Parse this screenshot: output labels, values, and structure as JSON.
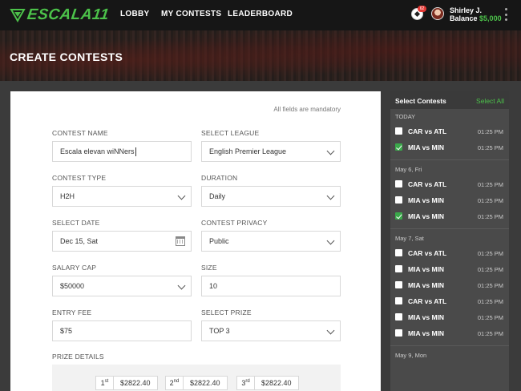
{
  "app": {
    "logo_text": "ESCALA11"
  },
  "nav": {
    "items": [
      {
        "label": "LOBBY"
      },
      {
        "label": "MY CONTESTS"
      },
      {
        "label": "LEADERBOARD"
      }
    ]
  },
  "user": {
    "notification_count": "62",
    "name": "Shirley J.",
    "balance_label": "Balance",
    "balance_amount": "$5,000"
  },
  "hero": {
    "title": "CREATE CONTESTS"
  },
  "form": {
    "mandatory_note": "All fields are mandatory",
    "contest_name": {
      "label": "CONTEST NAME",
      "value": "Escala elevan wiNNers"
    },
    "league": {
      "label": "SELECT LEAGUE",
      "value": "English Premier League"
    },
    "contest_type": {
      "label": "CONTEST TYPE",
      "value": "H2H"
    },
    "duration": {
      "label": "DURATION",
      "value": "Daily"
    },
    "date": {
      "label": "SELECT DATE",
      "value": "Dec 15, Sat"
    },
    "privacy": {
      "label": "CONTEST PRIVACY",
      "value": "Public"
    },
    "salary_cap": {
      "label": "SALARY CAP",
      "value": "$50000"
    },
    "size": {
      "label": "SIZE",
      "value": "10"
    },
    "entry_fee": {
      "label": "ENTRY FEE",
      "value": "$75"
    },
    "prize": {
      "label": "SELECT PRIZE",
      "value": "TOP 3"
    },
    "prize_details": {
      "label": "PRIZE DETAILS",
      "items": [
        {
          "rank": "1",
          "suffix": "st",
          "amount": "$2822.40"
        },
        {
          "rank": "2",
          "suffix": "nd",
          "amount": "$2822.40"
        },
        {
          "rank": "3",
          "suffix": "rd",
          "amount": "$2822.40"
        }
      ]
    }
  },
  "panel": {
    "title": "Select Contests",
    "select_all": "Select All",
    "groups": [
      {
        "label": "TODAY",
        "matches": [
          {
            "name": "CAR vs ATL",
            "time": "01:25 PM",
            "checked": false
          },
          {
            "name": "MIA vs MIN",
            "time": "01:25 PM",
            "checked": true
          }
        ]
      },
      {
        "label": "May 6, Fri",
        "matches": [
          {
            "name": "CAR vs ATL",
            "time": "01:25 PM",
            "checked": false
          },
          {
            "name": "MIA vs MIN",
            "time": "01:25 PM",
            "checked": false
          },
          {
            "name": "MIA vs MIN",
            "time": "01:25 PM",
            "checked": true
          }
        ]
      },
      {
        "label": "May 7, Sat",
        "matches": [
          {
            "name": "CAR vs ATL",
            "time": "01:25 PM",
            "checked": false
          },
          {
            "name": "MIA vs MIN",
            "time": "01:25 PM",
            "checked": false
          },
          {
            "name": "MIA vs MIN",
            "time": "01:25 PM",
            "checked": false
          },
          {
            "name": "CAR vs ATL",
            "time": "01:25 PM",
            "checked": false
          },
          {
            "name": "MIA vs MIN",
            "time": "01:25 PM",
            "checked": false
          },
          {
            "name": "MIA vs MIN",
            "time": "01:25 PM",
            "checked": false
          }
        ]
      },
      {
        "label": "May 9, Mon",
        "matches": []
      }
    ]
  },
  "colors": {
    "accent": "#4cc24a",
    "topbar": "#161616",
    "panel": "#4a4a4a"
  }
}
